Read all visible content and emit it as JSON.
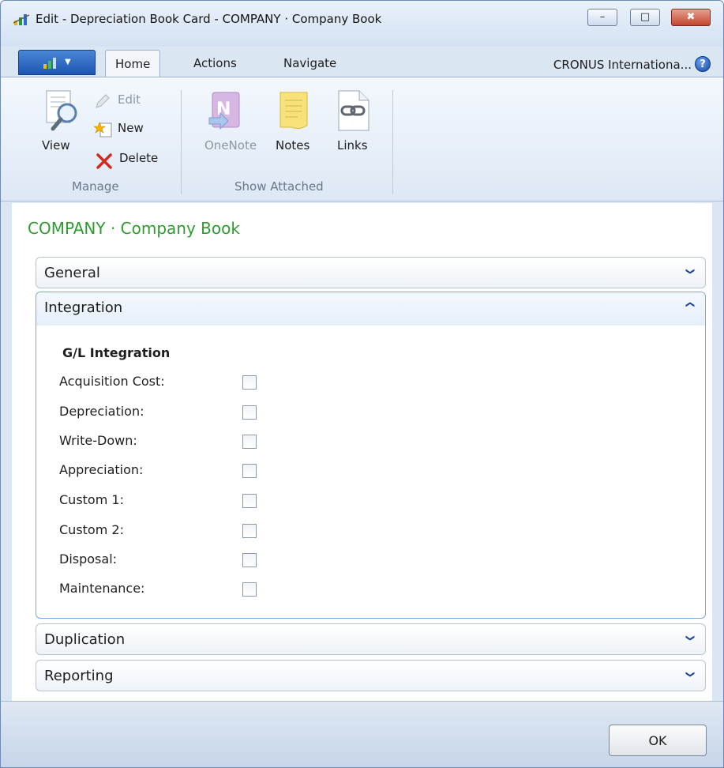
{
  "window": {
    "title": "Edit - Depreciation Book Card - COMPANY · Company Book",
    "minimize_glyph": "–",
    "maximize_glyph": "□",
    "close_glyph": "✖"
  },
  "ribbon": {
    "tabs": [
      {
        "label": "Home"
      },
      {
        "label": "Actions"
      },
      {
        "label": "Navigate"
      }
    ],
    "company": "CRONUS Internationa...",
    "help": "?",
    "groups": {
      "manage": {
        "label": "Manage",
        "view": "View",
        "edit": "Edit",
        "new": "New",
        "delete": "Delete"
      },
      "show_attached": {
        "label": "Show Attached",
        "onenote": "OneNote",
        "notes": "Notes",
        "links": "Links"
      }
    }
  },
  "page": {
    "title": "COMPANY · Company Book"
  },
  "fasttabs": {
    "general": "General",
    "integration": "Integration",
    "duplication": "Duplication",
    "reporting": "Reporting"
  },
  "integration": {
    "subheading": "G/L Integration",
    "fields": [
      {
        "label": "Acquisition Cost:",
        "checked": false
      },
      {
        "label": "Depreciation:",
        "checked": false
      },
      {
        "label": "Write-Down:",
        "checked": false
      },
      {
        "label": "Appreciation:",
        "checked": false
      },
      {
        "label": "Custom 1:",
        "checked": false
      },
      {
        "label": "Custom 2:",
        "checked": false
      },
      {
        "label": "Disposal:",
        "checked": false
      },
      {
        "label": "Maintenance:",
        "checked": false
      }
    ]
  },
  "footer": {
    "ok": "OK"
  },
  "colors": {
    "page_title": "#2e9b2e",
    "app_menu": "#1d56b4",
    "expanded_border": "#7ba7dc"
  }
}
